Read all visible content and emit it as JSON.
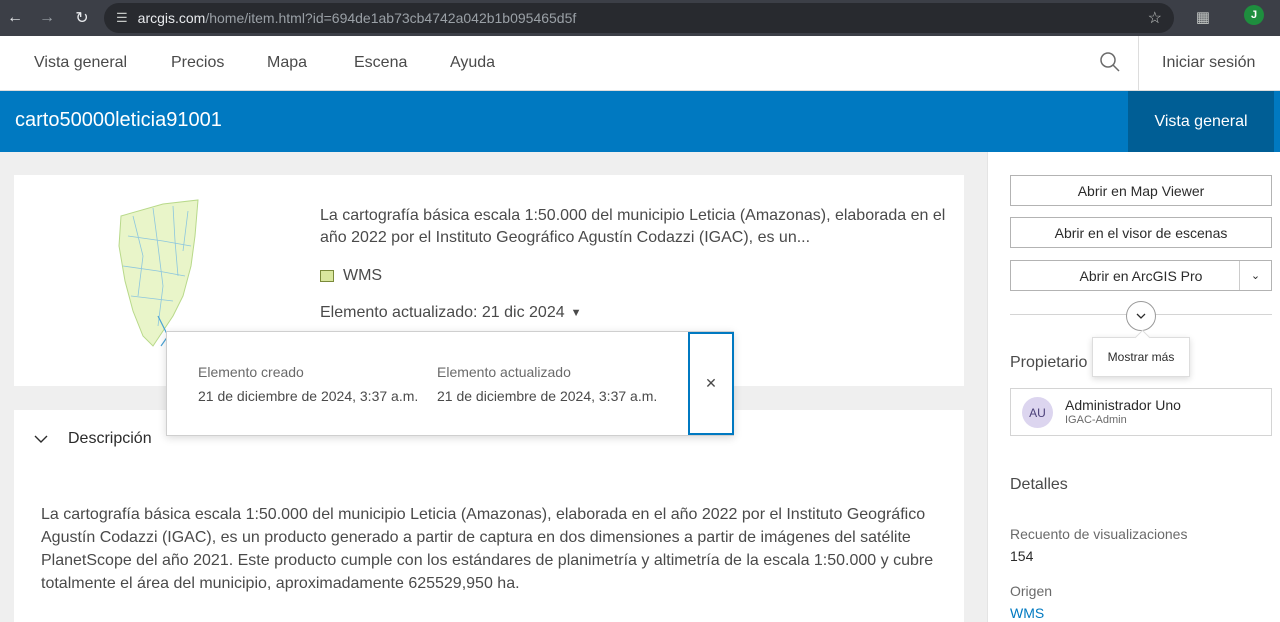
{
  "browser": {
    "url_host": "arcgis.com",
    "url_path": "/home/item.html?id=694de1ab73cb4742a042b1b095465d5f",
    "profile_initial": "J"
  },
  "topnav": {
    "items": [
      "Vista general",
      "Precios",
      "Mapa",
      "Escena",
      "Ayuda"
    ],
    "signin": "Iniciar sesión"
  },
  "header": {
    "title": "carto50000leticia91001",
    "tab": "Vista general"
  },
  "item": {
    "summary": "La cartografía básica escala 1:50.000 del municipio Leticia (Amazonas), elaborada en el año 2022 por el Instituto Geográfico Agustín Codazzi (IGAC), es un...",
    "type": "WMS",
    "updated_label": "Elemento actualizado: 21 dic 2024"
  },
  "popover": {
    "created_label": "Elemento creado",
    "created_value": "21 de diciembre de 2024, 3:37 a.m.",
    "updated_label": "Elemento actualizado",
    "updated_value": "21 de diciembre de 2024, 3:37 a.m."
  },
  "description": {
    "heading": "Descripción",
    "body": "La cartografía básica escala 1:50.000 del municipio Leticia (Amazonas), elaborada en el año 2022 por el Instituto Geográfico Agustín Codazzi (IGAC), es un producto generado a partir de captura en dos dimensiones a partir de imágenes del satélite PlanetScope del año 2021. Este producto cumple con los estándares de planimetría y altimetría de la escala 1:50.000 y cubre totalmente el área del municipio, aproximadamente 625529,950 ha."
  },
  "sidebar": {
    "btn_map_viewer": "Abrir en Map Viewer",
    "btn_scene_viewer": "Abrir en el visor de escenas",
    "btn_arcgis_pro": "Abrir en ArcGIS Pro",
    "tooltip": "Mostrar más",
    "owner_heading": "Propietario",
    "owner_initials": "AU",
    "owner_name": "Administrador Uno",
    "owner_username": "IGAC-Admin",
    "details_heading": "Detalles",
    "views_label": "Recuento de visualizaciones",
    "views_value": "154",
    "source_label": "Origen",
    "source_value": "WMS"
  },
  "colors": {
    "brand_blue": "#0079c1",
    "brand_blue_dark": "#005e95"
  }
}
